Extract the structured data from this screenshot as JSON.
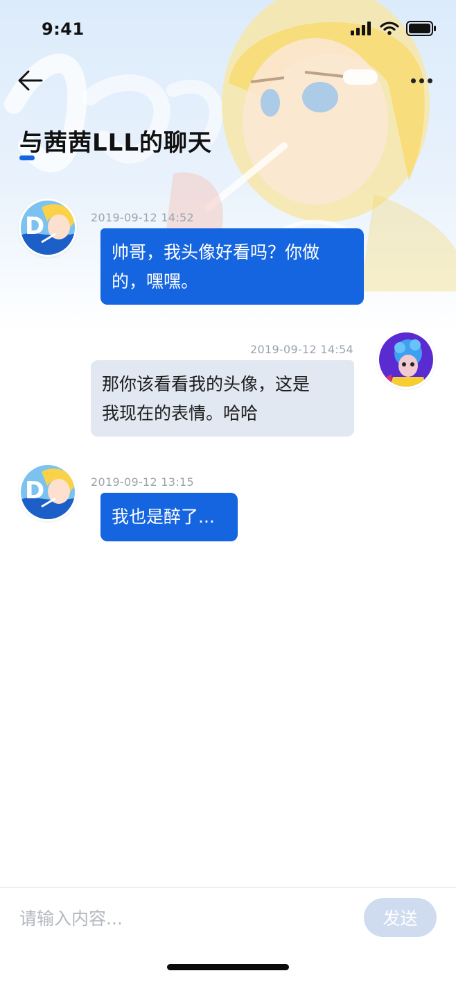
{
  "status_bar": {
    "time": "9:41"
  },
  "header": {
    "title": "与茜茜LLL的聊天",
    "back_icon": "arrow-left-icon",
    "more_icon": "more-dots-icon"
  },
  "messages": [
    {
      "direction": "incoming",
      "timestamp": "2019-09-12  14:52",
      "lines": [
        "帅哥，我头像好看吗？你做",
        "的，嘿嘿。"
      ]
    },
    {
      "direction": "outgoing",
      "timestamp": "2019-09-12  14:54",
      "lines": [
        "那你该看看我的头像，这是",
        "我现在的表情。哈哈"
      ]
    },
    {
      "direction": "incoming",
      "timestamp": "2019-09-12  13:15",
      "lines": [
        "我也是醉了..."
      ]
    }
  ],
  "composer": {
    "placeholder": "请输入内容...",
    "send_label": "发送"
  },
  "colors": {
    "accent": "#1565e0",
    "outgoing_bubble": "#e1e8f2",
    "timestamp": "#9aa3ad",
    "send_disabled": "#cfdcf0"
  }
}
